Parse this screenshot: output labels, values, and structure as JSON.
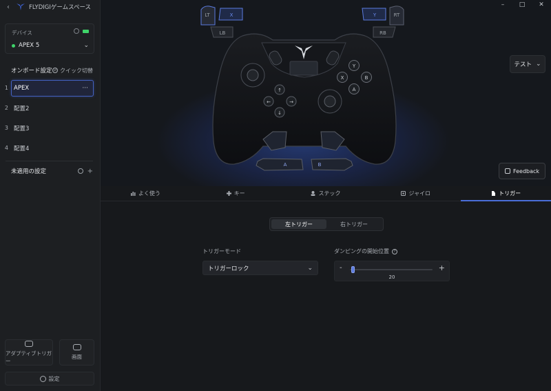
{
  "app": {
    "title": "FLYDIGIゲームスペース"
  },
  "window": {
    "minimize": "–",
    "maximize": "□",
    "close": "✕"
  },
  "device": {
    "label": "デバイス",
    "name": "APEX 5",
    "connected": true,
    "status_color": "#3fd46a"
  },
  "onboard": {
    "title": "オンボード設定",
    "quick_switch": "クイック切替",
    "configs": [
      {
        "num": "1",
        "name": "APEX",
        "active": true,
        "more": "···"
      },
      {
        "num": "2",
        "name": "配置2",
        "active": false
      },
      {
        "num": "3",
        "name": "配置3",
        "active": false
      },
      {
        "num": "4",
        "name": "配置4",
        "active": false
      }
    ]
  },
  "unapplied": {
    "title": "未適用の設定",
    "add": "+"
  },
  "sidebar_buttons": {
    "adaptive_trigger": "アダプティブトリガー",
    "screen": "画面",
    "settings": "設定"
  },
  "controller": {
    "buttons": {
      "lt": "LT",
      "rt": "RT",
      "lb": "LB",
      "rb": "RB",
      "x_top": "X",
      "y_top": "Y",
      "y": "Y",
      "x": "X",
      "b": "B",
      "a": "A",
      "back_a": "A",
      "back_b": "B"
    }
  },
  "test": {
    "label": "テスト"
  },
  "feedback": {
    "label": "Feedback"
  },
  "tabs": [
    {
      "label": "よく使う",
      "icon": "bar-chart-icon",
      "active": false
    },
    {
      "label": "キー",
      "icon": "dpad-icon",
      "active": false
    },
    {
      "label": "ステック",
      "icon": "stick-icon",
      "active": false
    },
    {
      "label": "ジャイロ",
      "icon": "gyro-icon",
      "active": false
    },
    {
      "label": "トリガー",
      "icon": "trigger-icon",
      "active": true
    }
  ],
  "trigger": {
    "segments": [
      {
        "label": "左トリガー",
        "active": true
      },
      {
        "label": "右トリガー",
        "active": false
      }
    ],
    "mode_label": "トリガーモード",
    "mode_value": "トリガーロック",
    "damping_label": "ダンピングの開始位置",
    "damping_value": "20",
    "damping_fraction": 0.02,
    "minus": "-",
    "plus": "+"
  },
  "accent_color": "#4a6ed8"
}
